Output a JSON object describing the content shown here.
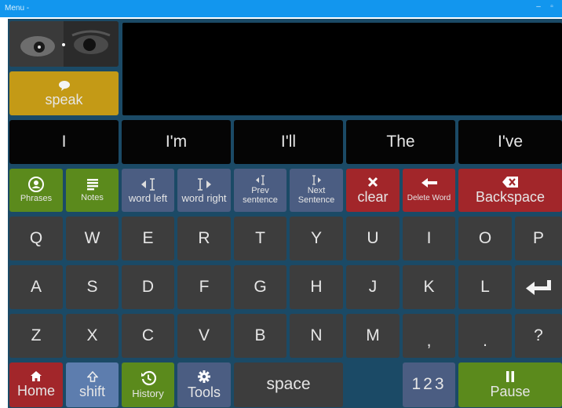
{
  "window": {
    "title": "Menu -",
    "controls": [
      "minimize-icon",
      "maximize-icon"
    ]
  },
  "speak": {
    "label": "speak",
    "icon": "speech-bubble-icon"
  },
  "text_area": {
    "content": ""
  },
  "predictions": [
    "I",
    "I'm",
    "I'll",
    "The",
    "I've"
  ],
  "toolbar": {
    "phrases": "Phrases",
    "notes": "Notes",
    "word_left": "word left",
    "word_right": "word right",
    "prev_sentence": "Prev sentence",
    "next_sentence": "Next Sentence",
    "clear": "clear",
    "delete_word": "Delete Word",
    "backspace": "Backspace"
  },
  "keys": {
    "row1": [
      "Q",
      "W",
      "E",
      "R",
      "T",
      "Y",
      "U",
      "I",
      "O",
      "P"
    ],
    "row2": [
      "A",
      "S",
      "D",
      "F",
      "G",
      "H",
      "J",
      "K",
      "L"
    ],
    "row3": [
      "Z",
      "X",
      "C",
      "V",
      "B",
      "N",
      "M",
      ",",
      ".",
      "?"
    ]
  },
  "bottom": {
    "home": "Home",
    "shift": "shift",
    "history": "History",
    "tools": "Tools",
    "space": "space",
    "numbers": "123",
    "pause": "Pause"
  },
  "colors": {
    "background": "#1b4a66",
    "key_gray": "#3d3d3d",
    "key_black": "#050505",
    "key_blue": "#4b5d82",
    "key_green": "#5b8a1c",
    "key_red": "#a2262a",
    "key_gold": "#c49a16",
    "title_bar": "#1296ee"
  }
}
